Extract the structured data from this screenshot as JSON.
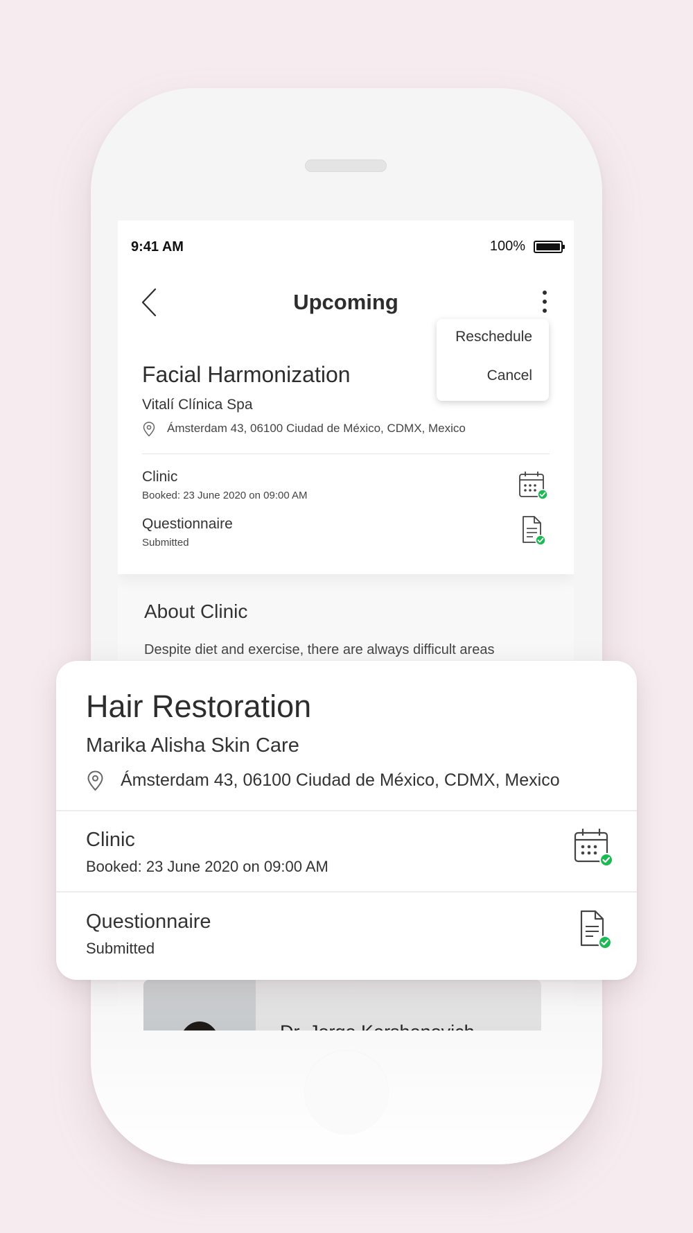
{
  "status": {
    "time": "9:41 AM",
    "battery": "100%"
  },
  "nav": {
    "title": "Upcoming"
  },
  "menu": {
    "items": [
      "Reschedule",
      "Cancel"
    ]
  },
  "appointment": {
    "title": "Facial Harmonization",
    "clinic": "Vitalí Clínica Spa",
    "address": "Ámsterdam 43, 06100 Ciudad de México, CDMX, Mexico",
    "clinic_row": {
      "label": "Clinic",
      "sub": "Booked: 23 June 2020 on 09:00 AM"
    },
    "questionnaire_row": {
      "label": "Questionnaire",
      "sub": "Submitted"
    }
  },
  "about": {
    "title": "About Clinic",
    "text": "Despite diet and exercise, there are always difficult areas"
  },
  "doctor": {
    "name": "Dr. Jorge Kershenovich"
  },
  "featured": {
    "title": "Hair Restoration",
    "clinic": "Marika Alisha Skin Care",
    "address": "Ámsterdam 43, 06100 Ciudad de México, CDMX, Mexico",
    "clinic_row": {
      "label": "Clinic",
      "sub": "Booked: 23 June 2020 on 09:00 AM"
    },
    "questionnaire_row": {
      "label": "Questionnaire",
      "sub": "Submitted"
    }
  },
  "colors": {
    "background": "#f6ecef",
    "check_green": "#1db954",
    "text_dark": "#2d2d2d"
  }
}
